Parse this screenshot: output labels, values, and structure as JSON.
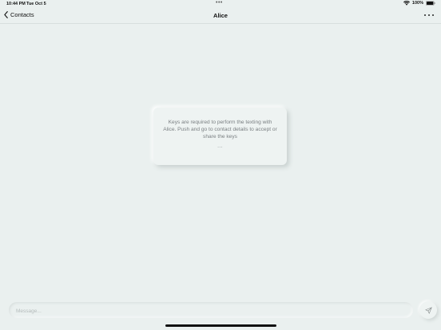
{
  "status_bar": {
    "time": "10:44 PM",
    "date": "Tue Oct 5",
    "multitask_dots": "•••",
    "battery": "100%",
    "icons": [
      "wifi-icon",
      "battery-icon"
    ]
  },
  "nav": {
    "back_label": "Contacts",
    "title": "Alice",
    "more_icon": "ellipsis-icon"
  },
  "notice": {
    "text": "Keys are required to perform the texting with Alice. Push and go to contact details to accept or share the keys",
    "dots": "..."
  },
  "composer": {
    "placeholder": "Message...",
    "value": "",
    "send_icon": "paper-plane-icon"
  },
  "colors": {
    "background": "#eaf0ef",
    "card": "#eef3f2",
    "muted_text": "#7a7f82"
  }
}
